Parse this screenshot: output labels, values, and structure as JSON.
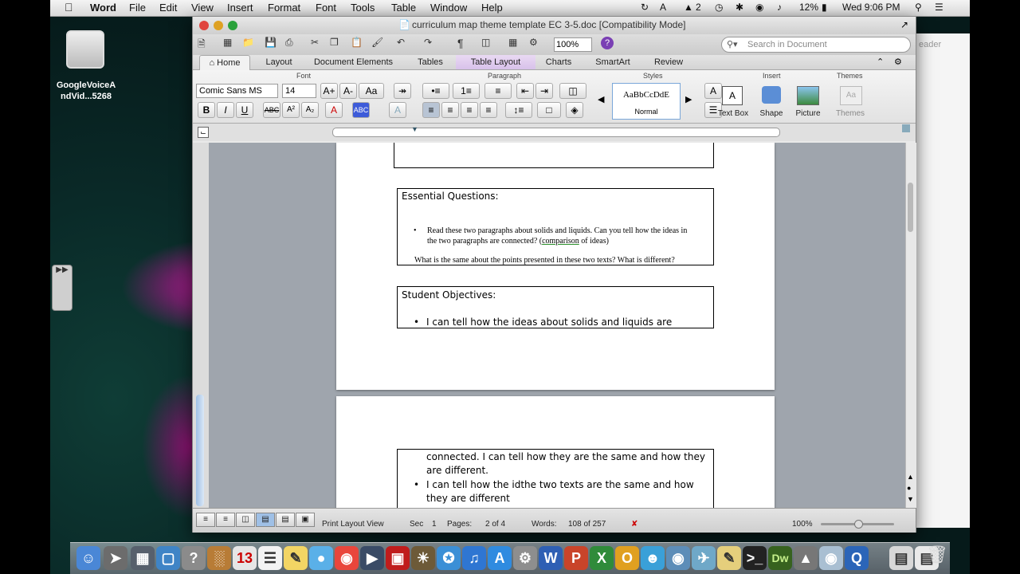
{
  "menubar": {
    "app": "Word",
    "items": [
      "File",
      "Edit",
      "View",
      "Insert",
      "Format",
      "Font",
      "Tools",
      "Table",
      "Window",
      "Help"
    ],
    "user_count": "2",
    "battery": "12%",
    "clock": "Wed 9:06 PM"
  },
  "desktop": {
    "icon_label": "GoogleVoiceA\nndVid...5268"
  },
  "window": {
    "title": "curriculum map theme template EC 3-5.doc [Compatibility Mode]",
    "zoom": "100%",
    "search_placeholder": "Search in Document",
    "bg_hint": "eader"
  },
  "ribbon_tabs": [
    "Home",
    "Layout",
    "Document Elements",
    "Tables",
    "Table Layout",
    "Charts",
    "SmartArt",
    "Review"
  ],
  "ribbon": {
    "groups": {
      "font": "Font",
      "paragraph": "Paragraph",
      "styles": "Styles",
      "insert": "Insert",
      "themes": "Themes"
    },
    "font_name": "Comic Sans MS",
    "font_size": "14",
    "style_preview": "AaBbCcDdE",
    "style_name": "Normal",
    "insert_items": [
      "Text Box",
      "Shape",
      "Picture"
    ],
    "themes_label": "Themes"
  },
  "document": {
    "essential": {
      "heading": "Essential Questions:",
      "bullet_1a": "Read these two paragraphs about solids and liquids. Can you tell how the ideas in",
      "bullet_1b": "the two paragraphs are connected? (",
      "bullet_1b_link": "comparison",
      "bullet_1b_end": " of ideas)",
      "line_2": "What is the same about the points presented in these two texts? What is different?"
    },
    "objectives": {
      "heading": "Student Objectives:",
      "bullet_1": "I can tell how the ideas about solids and liquids are"
    },
    "page2": {
      "line_1": "connected.  I can tell how they are the same and how they",
      "line_2": "are different.",
      "bullet_2a": "I can tell how the idthe two texts are the same and how",
      "bullet_2b": "they are different"
    }
  },
  "statusbar": {
    "view": "Print Layout View",
    "sec_label": "Sec",
    "sec_value": "1",
    "pages_label": "Pages:",
    "pages_value": "2 of 4",
    "words_label": "Words:",
    "words_value": "108 of 257",
    "zoom": "100%"
  },
  "dock_items": [
    "W",
    "P",
    "X",
    "O",
    "Dw"
  ]
}
